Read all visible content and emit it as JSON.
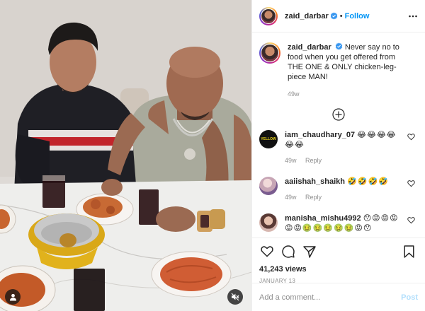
{
  "header": {
    "username": "zaid_darbar",
    "separator": "•",
    "follow_label": "Follow"
  },
  "caption": {
    "username": "zaid_darbar",
    "text": "Never say no to food when you get offered from THE ONE & ONLY chicken-leg-piece MAN!",
    "age": "49w"
  },
  "comments": [
    {
      "username": "iam_chaudhary_07",
      "text": "😂😂😂😂 😂😂",
      "age": "49w",
      "reply_label": "Reply",
      "avatar_text": "YELLOW"
    },
    {
      "username": "aaiishah_shaikh",
      "text": "🤣🤣🤣🤣",
      "age": "49w",
      "reply_label": "Reply"
    },
    {
      "username": "manisha_mishu4992",
      "text": "😯😡😡😡 😡😡🤢🤢🤢🤢🤢😡😯",
      "age": "",
      "reply_label": ""
    }
  ],
  "stats": {
    "views": "41,243 views",
    "date": "JANUARY 13"
  },
  "add_comment": {
    "placeholder": "Add a comment...",
    "post_label": "Post"
  },
  "icons": {
    "more": "more-dots-icon",
    "verified": "verified-badge-icon",
    "load_more": "plus-circle-icon",
    "like": "heart-icon",
    "comment": "comment-icon",
    "share": "paper-plane-icon",
    "save": "bookmark-icon",
    "user_tag": "user-tag-icon",
    "mute": "mute-icon"
  },
  "colors": {
    "accent": "#0095f6",
    "verified": "#3897f0",
    "muted_text": "#8e8e8e",
    "post_disabled": "#b2dffc"
  }
}
